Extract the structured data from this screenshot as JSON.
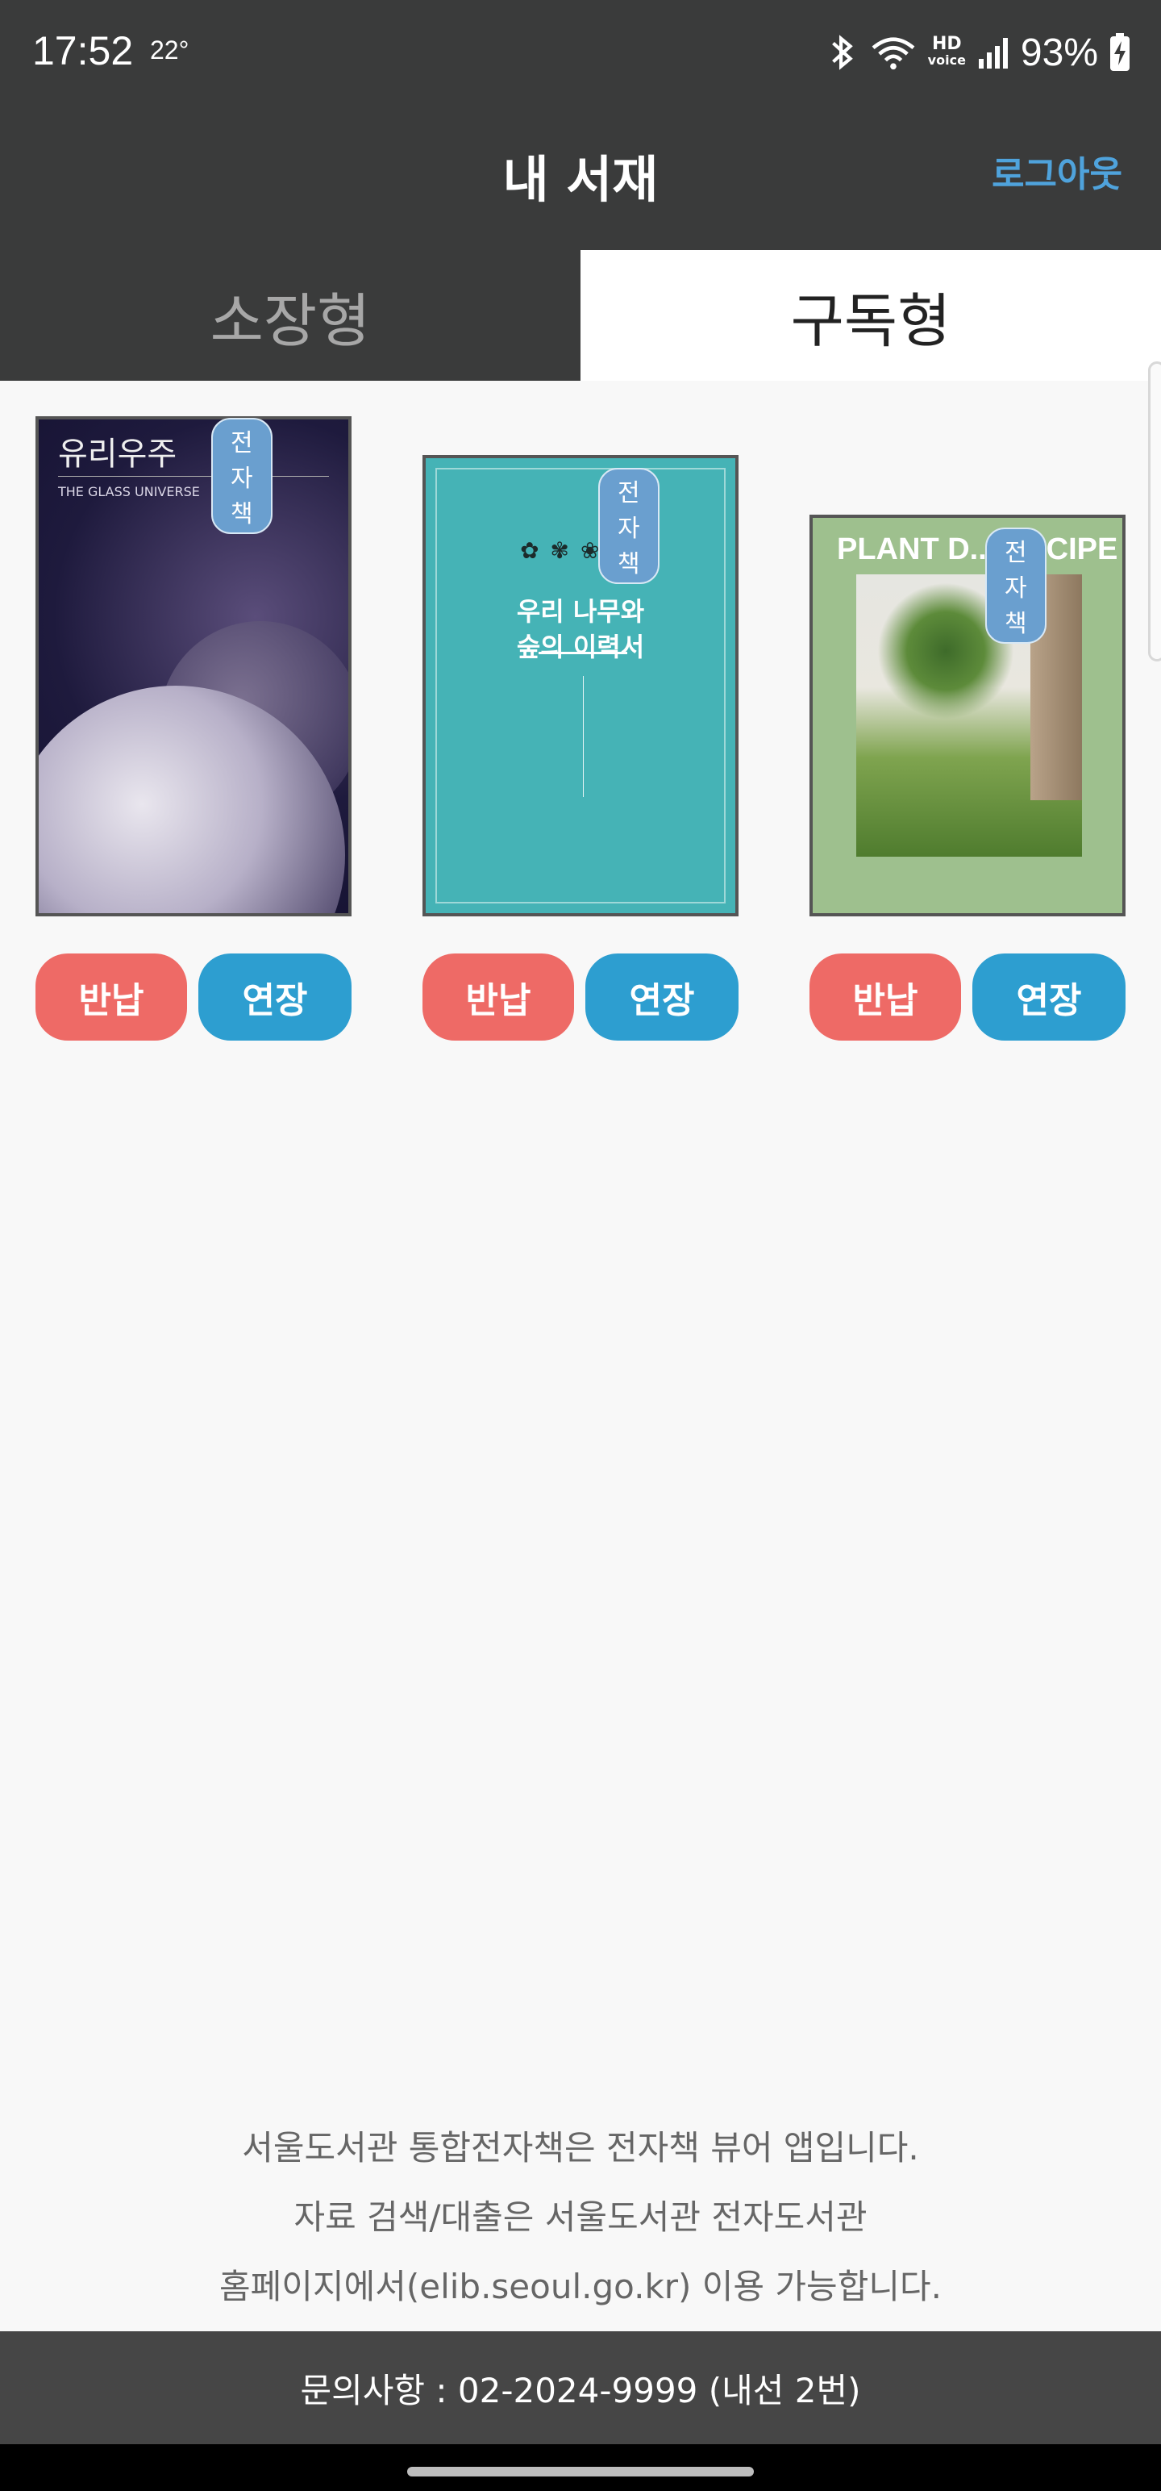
{
  "status_bar": {
    "time": "17:52",
    "temperature": "22°",
    "hd_label": "HD",
    "voice_label": "voice",
    "battery": "93%"
  },
  "app_bar": {
    "title": "내 서재",
    "logout": "로그아웃"
  },
  "tabs": [
    {
      "label": "소장형",
      "active": false
    },
    {
      "label": "구독형",
      "active": true
    }
  ],
  "books": [
    {
      "badge": "전자책",
      "cover_title": "유리우주",
      "cover_subtitle": "THE GLASS UNIVERSE",
      "return_label": "반납",
      "extend_label": "연장"
    },
    {
      "badge": "전자책",
      "cover_title": "우리 나무와 숲의 이력서",
      "return_label": "반납",
      "extend_label": "연장"
    },
    {
      "badge": "전자책",
      "cover_title": "PLANT D... RECIPE",
      "return_label": "반납",
      "extend_label": "연장"
    }
  ],
  "footer": {
    "line1": "서울도서관 통합전자책은 전자책 뷰어 앱입니다.",
    "line2": "자료 검색/대출은 서울도서관 전자도서관",
    "line3": "홈페이지에서(elib.seoul.go.kr) 이용 가능합니다.",
    "contact": "문의사항 : 02-2024-9999 (내선 2번)"
  },
  "colors": {
    "header_bg": "#3a3b3b",
    "accent_blue": "#4fa3dc",
    "return_red": "#ee6a66",
    "extend_blue": "#2d9ed0",
    "badge_blue": "#6a9fcf"
  }
}
